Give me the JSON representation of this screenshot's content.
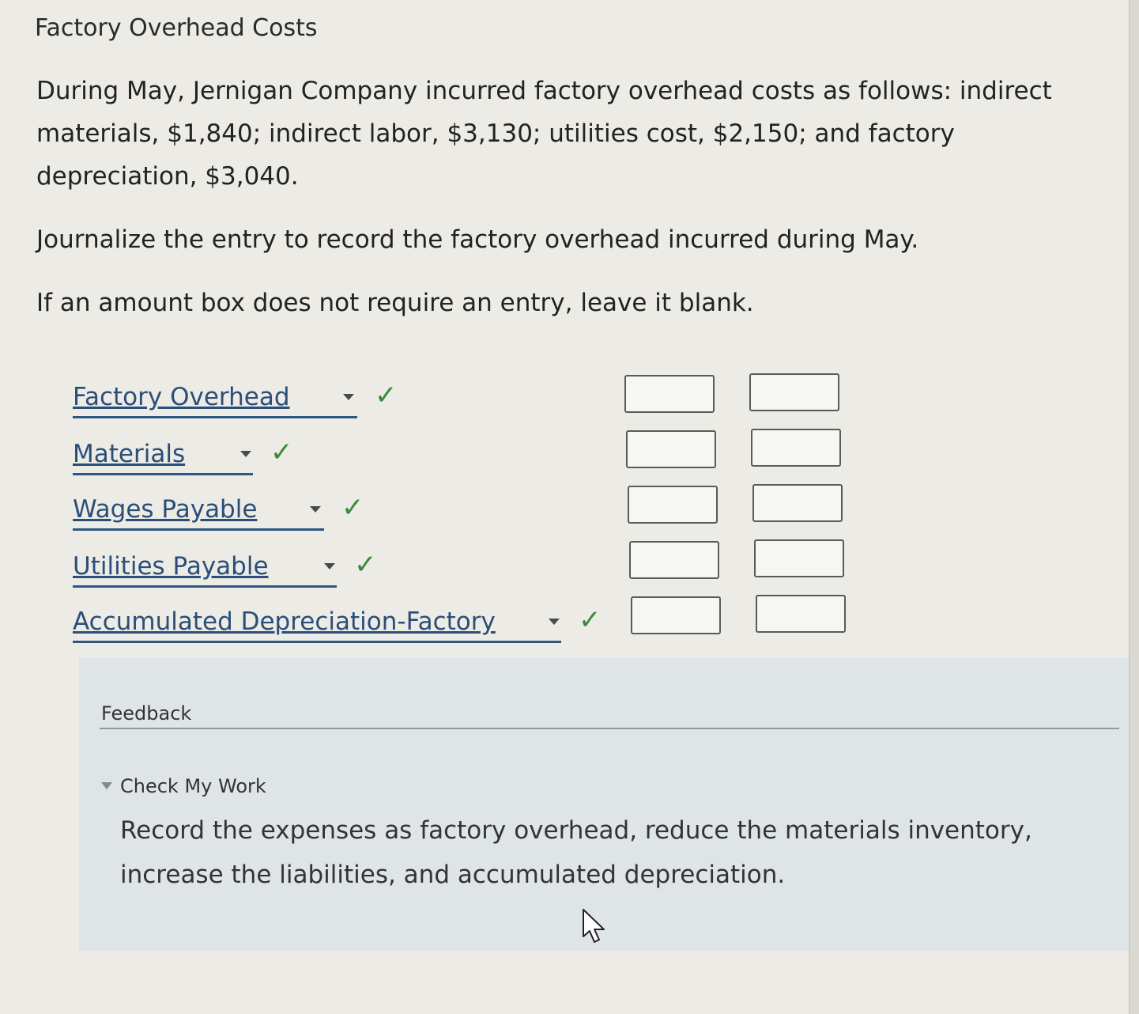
{
  "title": "Factory Overhead Costs",
  "problem_text": "During May, Jernigan Company incurred factory overhead costs as follows: indirect materials, $1,840; indirect labor, $3,130; utilities cost, $2,150; and factory depreciation, $3,040.",
  "instruction": "Journalize the entry to record the factory overhead incurred during May.",
  "note": "If an amount box does not require an entry, leave it blank.",
  "entries": [
    {
      "account": "Factory Overhead",
      "status": "✓",
      "debit": "",
      "credit": ""
    },
    {
      "account": "Materials",
      "status": "✓",
      "debit": "",
      "credit": ""
    },
    {
      "account": "Wages Payable",
      "status": "✓",
      "debit": "",
      "credit": ""
    },
    {
      "account": "Utilities Payable",
      "status": "✓",
      "debit": "",
      "credit": ""
    },
    {
      "account": "Accumulated Depreciation-Factory",
      "status": "✓",
      "debit": "",
      "credit": ""
    }
  ],
  "feedback": {
    "label": "Feedback",
    "check_my_work": "Check My Work",
    "text": "Record the expenses as factory overhead, reduce the materials inventory, increase the liabilities, and accumulated depreciation."
  },
  "colors": {
    "account_link": "#2b4e78",
    "check": "#3b8a3b",
    "feedback_bg": "#dfe4e6",
    "page_bg": "#ecebe5"
  }
}
